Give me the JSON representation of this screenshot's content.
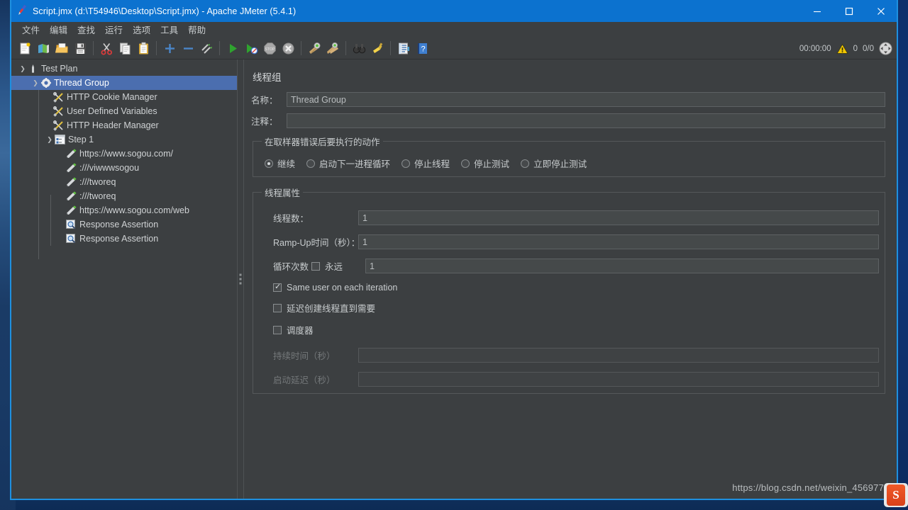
{
  "window": {
    "title": "Script.jmx (d:\\T54946\\Desktop\\Script.jmx) - Apache JMeter (5.4.1)",
    "app_icon": "jmeter-feather-icon",
    "minimize": "–",
    "maximize": "□",
    "close": "✕",
    "accent_color": "#0c72cf",
    "chrome_color": "#3c3f41"
  },
  "menubar": {
    "items": [
      {
        "label": "文件",
        "name": "menu-file"
      },
      {
        "label": "编辑",
        "name": "menu-edit"
      },
      {
        "label": "查找",
        "name": "menu-search"
      },
      {
        "label": "运行",
        "name": "menu-run"
      },
      {
        "label": "选项",
        "name": "menu-options"
      },
      {
        "label": "工具",
        "name": "menu-tools"
      },
      {
        "label": "帮助",
        "name": "menu-help"
      }
    ]
  },
  "toolbar": {
    "buttons": [
      {
        "icon": "new-document-icon"
      },
      {
        "icon": "open-templates-icon"
      },
      {
        "icon": "open-folder-icon"
      },
      {
        "icon": "save-floppy-icon"
      },
      {
        "sep": true
      },
      {
        "icon": "cut-scissors-icon"
      },
      {
        "icon": "copy-icon"
      },
      {
        "icon": "paste-clipboard-icon"
      },
      {
        "sep": true
      },
      {
        "icon": "expand-plus-icon"
      },
      {
        "icon": "collapse-minus-icon"
      },
      {
        "icon": "toggle-enable-icon"
      },
      {
        "sep": true
      },
      {
        "icon": "start-play-icon"
      },
      {
        "icon": "start-no-timers-icon"
      },
      {
        "icon": "stop-icon"
      },
      {
        "icon": "shutdown-icon"
      },
      {
        "sep": true
      },
      {
        "icon": "clear-icon"
      },
      {
        "icon": "clear-all-icon"
      },
      {
        "sep": true
      },
      {
        "icon": "search-binoculars-icon"
      },
      {
        "icon": "reset-search-icon"
      },
      {
        "sep": true
      },
      {
        "icon": "function-helper-icon"
      },
      {
        "icon": "help-book-icon"
      }
    ],
    "timer": "00:00:00",
    "warning_icon": "warning-triangle-icon",
    "warning_count": "0",
    "threads_count": "0/0",
    "expand_icon": "expand-arrows-icon"
  },
  "tree": {
    "nodes": [
      {
        "label": "Test Plan",
        "icon": "test-plan-icon",
        "depth": 0,
        "toggle": "open",
        "selected": false
      },
      {
        "label": "Thread Group",
        "icon": "thread-group-gear-icon",
        "depth": 1,
        "toggle": "open",
        "selected": true
      },
      {
        "label": "HTTP Cookie Manager",
        "icon": "config-element-icon",
        "depth": 2,
        "toggle": "none",
        "selected": false
      },
      {
        "label": "User Defined Variables",
        "icon": "config-element-icon",
        "depth": 2,
        "toggle": "none",
        "selected": false
      },
      {
        "label": "HTTP Header Manager",
        "icon": "config-element-icon",
        "depth": 2,
        "toggle": "none",
        "selected": false
      },
      {
        "label": "Step 1",
        "icon": "transaction-controller-icon",
        "depth": 2,
        "toggle": "open",
        "selected": false
      },
      {
        "label": "https://www.sogou.com/",
        "icon": "http-sampler-icon",
        "depth": 3,
        "toggle": "none",
        "selected": false
      },
      {
        "label": ":///viwwwsogou",
        "icon": "http-sampler-icon",
        "depth": 3,
        "toggle": "none",
        "selected": false
      },
      {
        "label": ":///tworeq",
        "icon": "http-sampler-icon",
        "depth": 3,
        "toggle": "none",
        "selected": false
      },
      {
        "label": ":///tworeq",
        "icon": "http-sampler-icon",
        "depth": 3,
        "toggle": "none",
        "selected": false
      },
      {
        "label": "https://www.sogou.com/web",
        "icon": "http-sampler-icon",
        "depth": 3,
        "toggle": "none",
        "selected": false
      },
      {
        "label": "Response Assertion",
        "icon": "assertion-magnifier-icon",
        "depth": 3,
        "toggle": "none",
        "selected": false
      },
      {
        "label": "Response Assertion",
        "icon": "assertion-magnifier-icon",
        "depth": 3,
        "toggle": "none",
        "selected": false
      }
    ]
  },
  "panel": {
    "title": "线程组",
    "name_label": "名称：",
    "name_value": "Thread Group",
    "comment_label": "注释：",
    "comment_value": "",
    "on_error": {
      "legend": "在取样器错误后要执行的动作",
      "options": [
        {
          "label": "继续",
          "selected": true
        },
        {
          "label": "启动下一进程循环",
          "selected": false
        },
        {
          "label": "停止线程",
          "selected": false
        },
        {
          "label": "停止测试",
          "selected": false
        },
        {
          "label": "立即停止测试",
          "selected": false
        }
      ]
    },
    "thread_props": {
      "legend": "线程属性",
      "num_threads_label": "线程数：",
      "num_threads_value": "1",
      "ramp_up_label": "Ramp-Up时间（秒）：",
      "ramp_up_value": "1",
      "loop_label": "循环次数",
      "forever_label": "永远",
      "forever_checked": false,
      "loop_value": "1",
      "same_user_label": "Same user on each iteration",
      "same_user_checked": true,
      "delay_thread_label": "延迟创建线程直到需要",
      "delay_thread_checked": false,
      "scheduler_label": "调度器",
      "scheduler_checked": false,
      "duration_label": "持续时间（秒）",
      "duration_value": "",
      "startup_delay_label": "启动延迟（秒）",
      "startup_delay_value": ""
    }
  },
  "watermark": {
    "text": "https://blog.csdn.net/weixin_456977",
    "icon": "wps-app-icon",
    "icon_glyph": "S"
  }
}
